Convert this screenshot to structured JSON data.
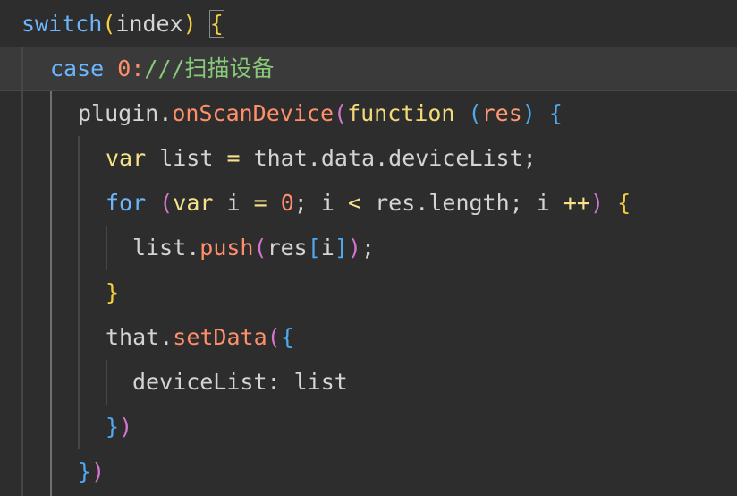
{
  "editor": {
    "theme": {
      "background": "#2d2d2d",
      "current_line_bg": "#3a3a3a",
      "keyword": "#6cb6ff",
      "function": "#ff8f6b",
      "number": "#ff8f6b",
      "comment": "#89c97a",
      "bracket_1": "#f4d040",
      "bracket_2": "#d574d0",
      "bracket_3": "#4fa9ef"
    },
    "lines": [
      {
        "tokens": [
          "switch",
          "(",
          "index",
          ")",
          " ",
          "{"
        ]
      },
      {
        "tokens": [
          "case",
          " ",
          "0",
          ":",
          "///扫描设备"
        ]
      },
      {
        "tokens": [
          "plugin",
          ".",
          "onScanDevice",
          "(",
          "function",
          " ",
          "(",
          "res",
          ")",
          " ",
          "{"
        ]
      },
      {
        "tokens": [
          "var",
          " list ",
          "=",
          " that",
          ".",
          "data",
          ".",
          "deviceList",
          ";"
        ]
      },
      {
        "tokens": [
          "for",
          " ",
          "(",
          "var",
          " i ",
          "=",
          " ",
          "0",
          "; i ",
          "<",
          " res",
          ".",
          "length",
          "; i ",
          "++",
          ")",
          " ",
          "{"
        ]
      },
      {
        "tokens": [
          "list",
          ".",
          "push",
          "(",
          "res",
          "[",
          "i",
          "]",
          ")",
          ";"
        ]
      },
      {
        "tokens": [
          "}"
        ]
      },
      {
        "tokens": [
          "that",
          ".",
          "setData",
          "(",
          "{"
        ]
      },
      {
        "tokens": [
          "deviceList",
          ": ",
          "list"
        ]
      },
      {
        "tokens": [
          "}",
          ")"
        ]
      },
      {
        "tokens": [
          "}",
          ")"
        ]
      }
    ]
  }
}
